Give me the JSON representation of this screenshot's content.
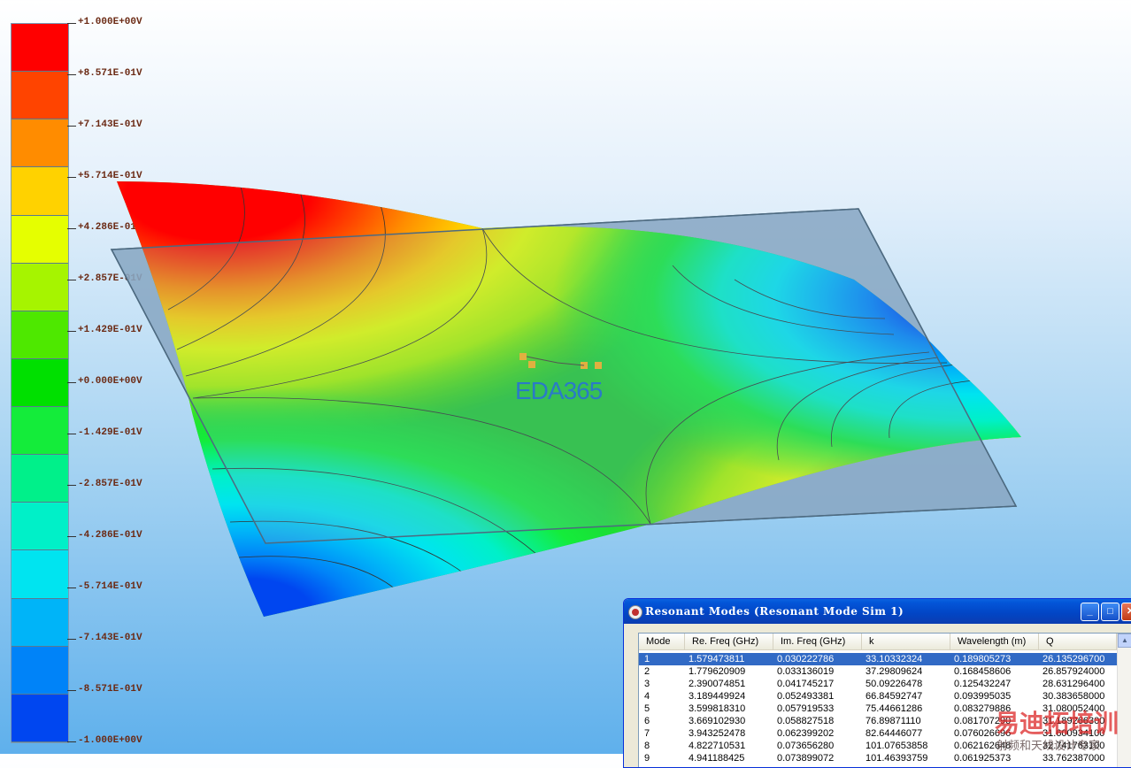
{
  "colorbar": {
    "colors": [
      "#ff0000",
      "#ff4400",
      "#ff8c00",
      "#ffd200",
      "#e5ff00",
      "#a6f400",
      "#4ee800",
      "#00e000",
      "#14ec3a",
      "#00f08a",
      "#00f0c8",
      "#00e4f0",
      "#00b4f8",
      "#0083f8",
      "#0046f0"
    ],
    "labels": [
      "+1.000E+00V",
      "+8.571E-01V",
      "+7.143E-01V",
      "+5.714E-01V",
      "+4.286E-01V",
      "+2.857E-01V",
      "+1.429E-01V",
      "+0.000E+00V",
      "-1.429E-01V",
      "-2.857E-01V",
      "-4.286E-01V",
      "-5.714E-01V",
      "-7.143E-01V",
      "-8.571E-01V",
      "-1.000E+00V"
    ]
  },
  "watermark": {
    "text": "EDA365",
    "logo_text": "易迪拓培训",
    "logo_sub": "射频和天线设计专家"
  },
  "dialog": {
    "title": "Resonant Modes (Resonant Mode Sim 1)",
    "buttons": {
      "minimize": "_",
      "maximize": "□",
      "close": "✕"
    },
    "columns": [
      "Mode",
      "Re. Freq (GHz)",
      "Im. Freq (GHz)",
      "k",
      "Wavelength (m)",
      "Q"
    ],
    "rows": [
      [
        "1",
        "1.579473811",
        "0.030222786",
        "33.10332324",
        "0.189805273",
        "26.135296700"
      ],
      [
        "2",
        "1.779620909",
        "0.033136019",
        "37.29809624",
        "0.168458606",
        "26.857924000"
      ],
      [
        "3",
        "2.390074851",
        "0.041745217",
        "50.09226478",
        "0.125432247",
        "28.631296400"
      ],
      [
        "4",
        "3.189449924",
        "0.052493381",
        "66.84592747",
        "0.093995035",
        "30.383658000"
      ],
      [
        "5",
        "3.599818310",
        "0.057919533",
        "75.44661286",
        "0.083279886",
        "31.080052400"
      ],
      [
        "6",
        "3.669102930",
        "0.058827518",
        "76.89871110",
        "0.081707290",
        "31.189266300"
      ],
      [
        "7",
        "3.943252478",
        "0.062399202",
        "82.64446077",
        "0.076026696",
        "31.600934100"
      ],
      [
        "8",
        "4.822710531",
        "0.073656280",
        "101.07653858",
        "0.062162648",
        "32.741763100"
      ],
      [
        "9",
        "4.941188425",
        "0.073899072",
        "101.46393759",
        "0.061925373",
        "33.762387000"
      ]
    ],
    "selected_row": 0
  }
}
